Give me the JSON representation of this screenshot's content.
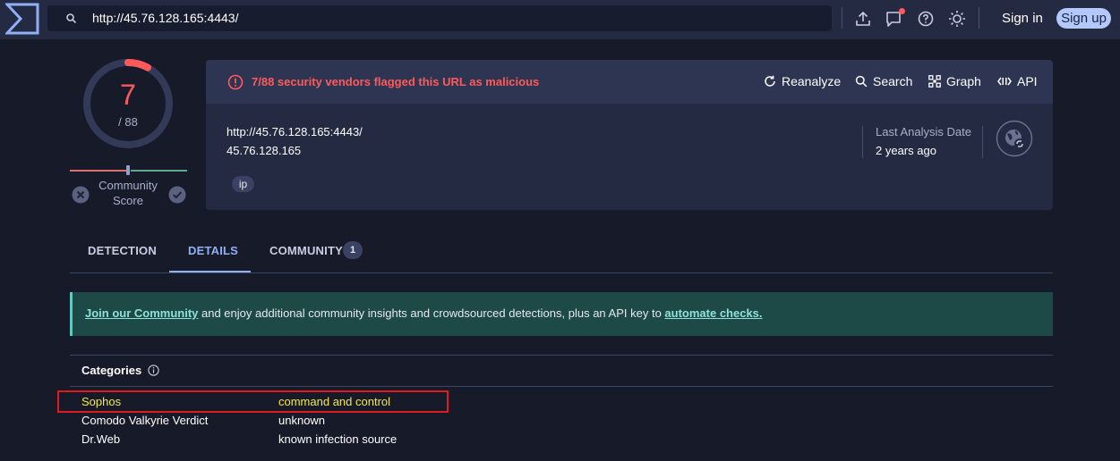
{
  "toolbar": {
    "url": "http://45.76.128.165:4443/",
    "sign_in": "Sign in",
    "sign_up": "Sign up"
  },
  "score": {
    "detections": "7",
    "total": "/ 88",
    "detection_fraction": 0.0795,
    "community_label": "Community Score"
  },
  "card": {
    "alert": "7/88 security vendors flagged this URL as malicious",
    "actions": [
      "Reanalyze",
      "Search",
      "Graph",
      "API"
    ],
    "url": "http://45.76.128.165:4443/",
    "ip": "45.76.128.165",
    "tag": "ip",
    "last_analysis_label": "Last Analysis Date",
    "last_analysis_value": "2 years ago"
  },
  "tabs": [
    {
      "label": "DETECTION"
    },
    {
      "label": "DETAILS"
    },
    {
      "label": "COMMUNITY",
      "badge": "1"
    }
  ],
  "banner": {
    "link1": "Join our Community",
    "middle": " and enjoy additional community insights and crowdsourced detections, plus an API key to ",
    "link2": "automate checks."
  },
  "categories": {
    "title": "Categories",
    "rows": [
      {
        "vendor": "Sophos",
        "category": "command and control"
      },
      {
        "vendor": "Comodo Valkyrie Verdict",
        "category": "unknown"
      },
      {
        "vendor": "Dr.Web",
        "category": "known infection source"
      }
    ]
  },
  "colors": {
    "background": "#171a29",
    "topbar": "#242a42",
    "malicious": "#ff5a5a",
    "accent": "#8fb0f5",
    "highlight": "#f5e84a"
  }
}
